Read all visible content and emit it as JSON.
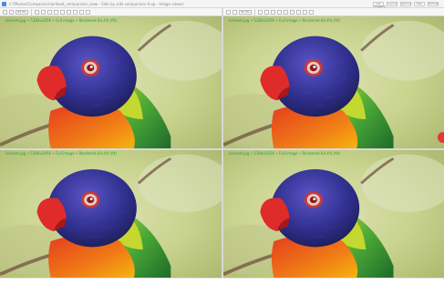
{
  "window": {
    "title": "C:\\Photos\\Comparison\\lorikeet_comparison_view - Side by side comparison 4-up - Image viewer",
    "buttons": [
      "Get Image(s)",
      "Layout",
      "Options",
      "Help",
      "Refresh"
    ]
  },
  "panes": [
    {
      "id": "top-left",
      "zoom": "64.4%",
      "info": "lorikeet.jpg  •  5184x3456  •  Full image  •  Rendered 64.4% (fit)",
      "toolbar_label": ""
    },
    {
      "id": "top-right",
      "zoom": "64.4%",
      "info": "lorikeet.jpg  •  5184x3456  •  Full image  •  Rendered 64.4% (fit)",
      "toolbar_label": ""
    },
    {
      "id": "bottom-left",
      "zoom": "",
      "info": "lorikeet.jpg  •  5184x3456  •  Full image  •  Rendered 64.4% (fit)",
      "toolbar_label": ""
    },
    {
      "id": "bottom-right",
      "zoom": "",
      "info": "lorikeet.jpg  •  5184x3456  •  Full image  •  Rendered 64.4% (fit)",
      "toolbar_label": ""
    }
  ],
  "colors": {
    "info_text": "#1a9a1a",
    "accent_dot": "#e53935",
    "background_blur": "#cfd7a6"
  }
}
